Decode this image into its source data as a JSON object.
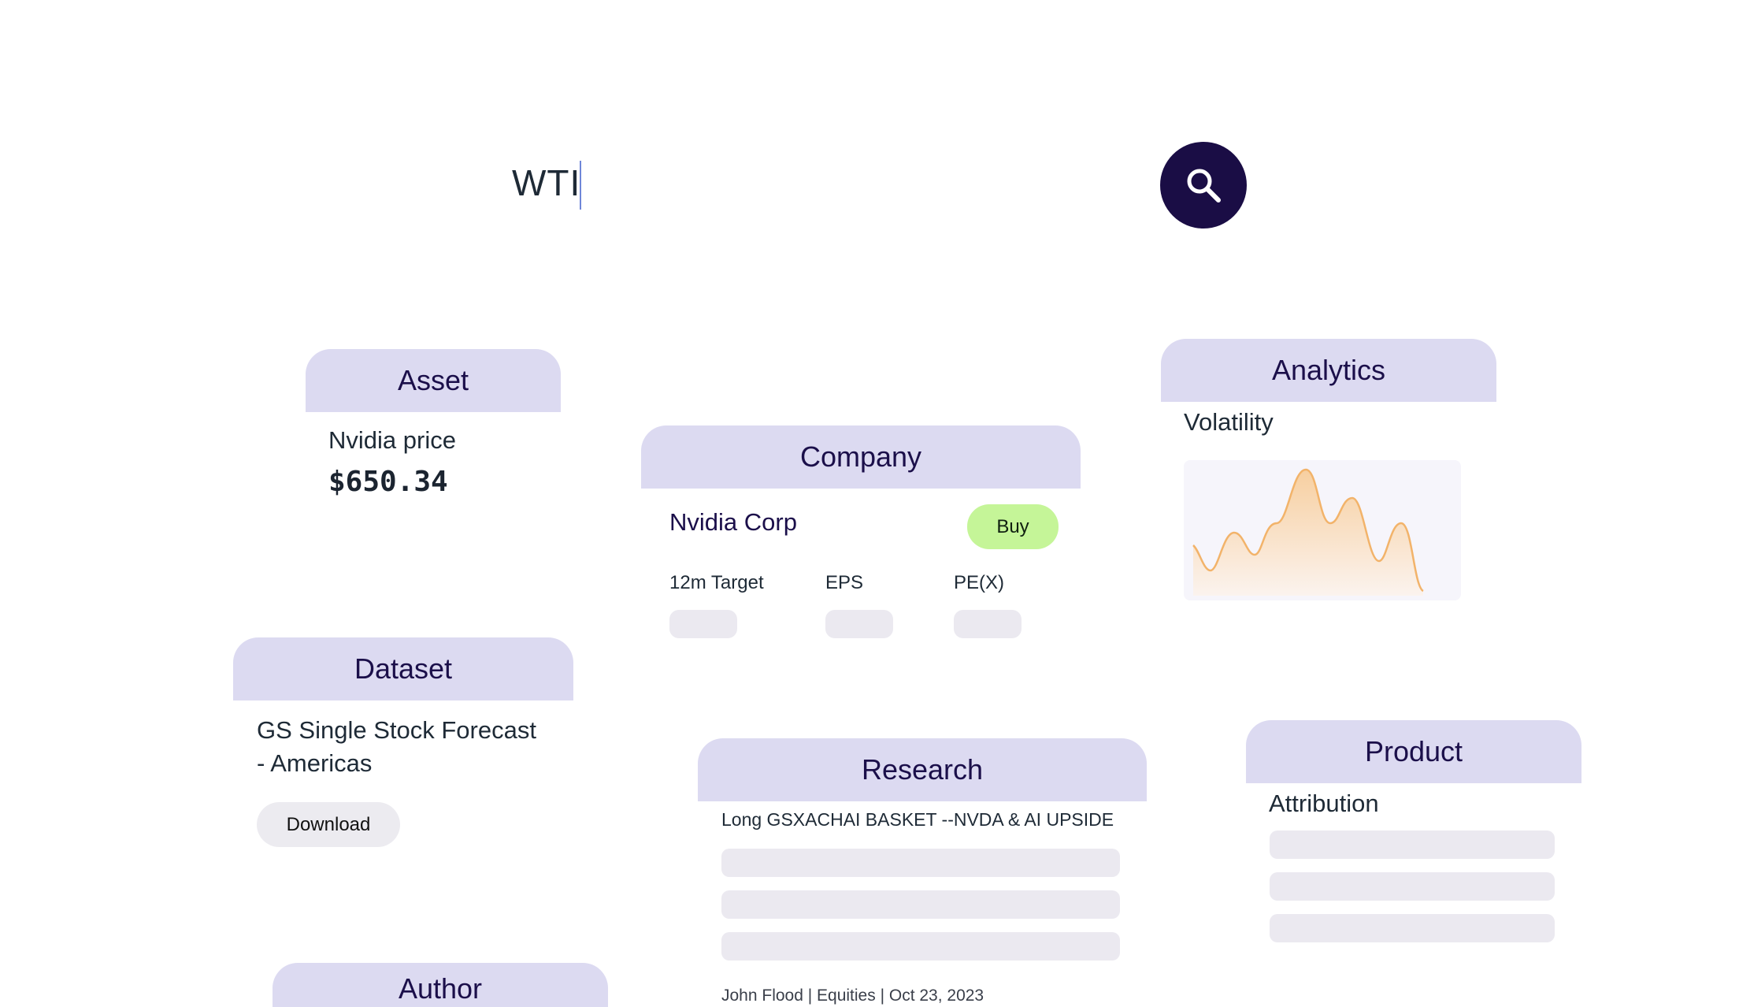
{
  "search": {
    "query": "WTI"
  },
  "asset": {
    "tab_label": "Asset",
    "item_label": "Nvidia price",
    "price": "$650.34"
  },
  "company": {
    "tab_label": "Company",
    "name": "Nvidia Corp",
    "rating_label": "Buy",
    "metrics": [
      "12m Target",
      "EPS",
      "PE(X)"
    ]
  },
  "analytics": {
    "tab_label": "Analytics",
    "item_label": "Volatility",
    "chart_colors": {
      "line": "#f2b36a",
      "fill_top": "#f7cfa0",
      "fill_bottom": "#fbf3ee",
      "background": "#f6f5fb"
    }
  },
  "dataset": {
    "tab_label": "Dataset",
    "title_line1": "GS Single Stock Forecast",
    "title_line2": "- Americas",
    "download_label": "Download"
  },
  "research": {
    "tab_label": "Research",
    "headline": "Long GSXACHAI BASKET --NVDA & AI UPSIDE",
    "byline": "John Flood | Equities | Oct 23, 2023"
  },
  "product": {
    "tab_label": "Product",
    "item_label": "Attribution"
  },
  "author": {
    "tab_label": "Author"
  },
  "colors": {
    "tab_bg": "#dcdaf1",
    "tab_text": "#1b0f4a",
    "search_button": "#1a0d45",
    "buy_button": "#c5f598",
    "skeleton": "#ebe9f0"
  }
}
